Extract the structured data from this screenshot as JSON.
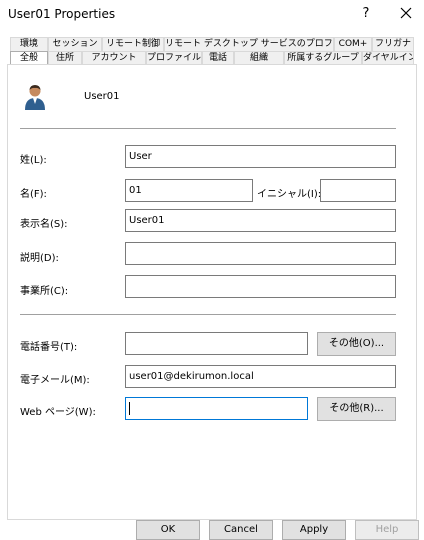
{
  "window": {
    "title": "User01 Properties",
    "help_glyph": "?",
    "close_glyph": "✕"
  },
  "tabs": {
    "row1": [
      "環境",
      "セッション",
      "リモート制御",
      "リモート デスクトップ サービスのプロファイル",
      "COM+",
      "フリガナ"
    ],
    "row2": [
      "全般",
      "住所",
      "アカウント",
      "プロファイル",
      "電話",
      "組織",
      "所属するグループ",
      "ダイヤルイン"
    ]
  },
  "user": {
    "name": "User01"
  },
  "fields": {
    "last_name": {
      "label": "姓(L):",
      "value": "User"
    },
    "first_name": {
      "label": "名(F):",
      "value": "01"
    },
    "initials": {
      "label": "イニシャル(I):",
      "value": ""
    },
    "display_name": {
      "label": "表示名(S):",
      "value": "User01"
    },
    "description": {
      "label": "説明(D):",
      "value": ""
    },
    "office": {
      "label": "事業所(C):",
      "value": ""
    },
    "phone": {
      "label": "電話番号(T):",
      "value": ""
    },
    "email": {
      "label": "電子メール(M):",
      "value": "user01@dekirumon.local"
    },
    "web": {
      "label": "Web ページ(W):",
      "value": ""
    }
  },
  "buttons": {
    "other_phone": "その他(O)...",
    "other_web": "その他(R)...",
    "ok": "OK",
    "cancel": "Cancel",
    "apply": "Apply",
    "help": "Help"
  },
  "icons": {
    "user": "user-avatar-icon"
  }
}
